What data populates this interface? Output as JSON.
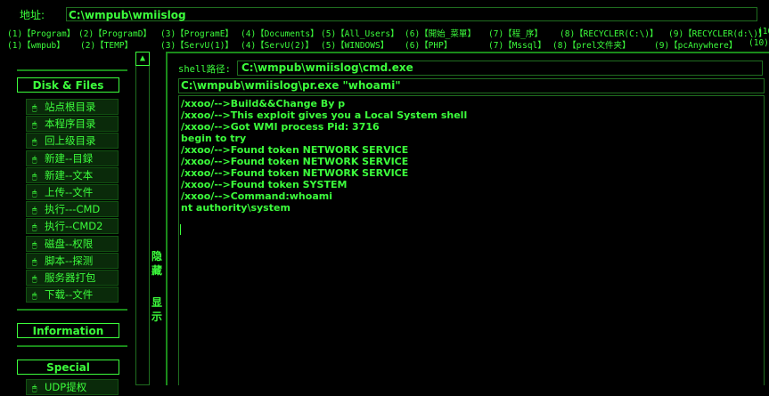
{
  "address": {
    "label": "地址:",
    "value": "C:\\wmpub\\wmiislog"
  },
  "drives_row1": [
    "(1)【Program】",
    "(2)【ProgramD】",
    "(3)【ProgramE】",
    "(4)【Documents】",
    "(5)【All_Users】",
    "(6)【開始_菜單】",
    "(7)【程_序】",
    "(8)【RECYCLER(C:\\)】",
    "(9)【RECYCLER(d:\\)】",
    "(10"
  ],
  "drives_row2": [
    "(1)【wmpub】",
    "(2)【TEMP】",
    "(3)【ServU(1)】",
    "(4)【ServU(2)】",
    "(5)【WINDOWS】",
    "(6)【PHP】",
    "(7)【Mssql】",
    "(8)【prel文件夹】",
    "(9)【pcAnywhere】",
    "(10)"
  ],
  "sidebar": {
    "disk_files": "Disk & Files",
    "items": [
      {
        "label": "站点根目录",
        "icon": "mouse-icon"
      },
      {
        "label": "本程序目录",
        "icon": "mouse-icon"
      },
      {
        "label": "回上级目录",
        "icon": "mouse-icon"
      },
      {
        "label": "新建--目録",
        "icon": "mouse-icon"
      },
      {
        "label": "新建--文本",
        "icon": "mouse-icon"
      },
      {
        "label": "上传--文件",
        "icon": "mouse-icon"
      },
      {
        "label": "执行---CMD",
        "icon": "mouse-icon"
      },
      {
        "label": "执行--CMD2",
        "icon": "mouse-icon"
      },
      {
        "label": "磁盘--权限",
        "icon": "mouse-icon"
      },
      {
        "label": "脚本--探测",
        "icon": "mouse-icon"
      },
      {
        "label": "服务器打包",
        "icon": "mouse-icon"
      },
      {
        "label": "下载--文件",
        "icon": "mouse-icon"
      }
    ],
    "information": "Information",
    "special": "Special",
    "special_first": "UDP提权"
  },
  "toggle": {
    "arrow": "▲",
    "hide": "隐藏",
    "show": "显示"
  },
  "shell": {
    "label": "shell路径:",
    "path": "C:\\wmpub\\wmiislog\\cmd.exe"
  },
  "command": "C:\\wmpub\\wmiislog\\pr.exe \"whoami\"",
  "output_lines": [
    "/xxoo/-->Build&&Change By p",
    "/xxoo/-->This exploit gives you a Local System shell",
    "/xxoo/-->Got WMI process Pid: 3716",
    "begin to try",
    "/xxoo/-->Found token NETWORK SERVICE",
    "/xxoo/-->Found token NETWORK SERVICE",
    "/xxoo/-->Found token NETWORK SERVICE",
    "/xxoo/-->Found token SYSTEM",
    "/xxoo/-->Command:whoami",
    "nt authority\\system"
  ],
  "colors": {
    "text": "#3cfd3c",
    "background": "#000000",
    "menu_bg": "#0a2a0a"
  }
}
